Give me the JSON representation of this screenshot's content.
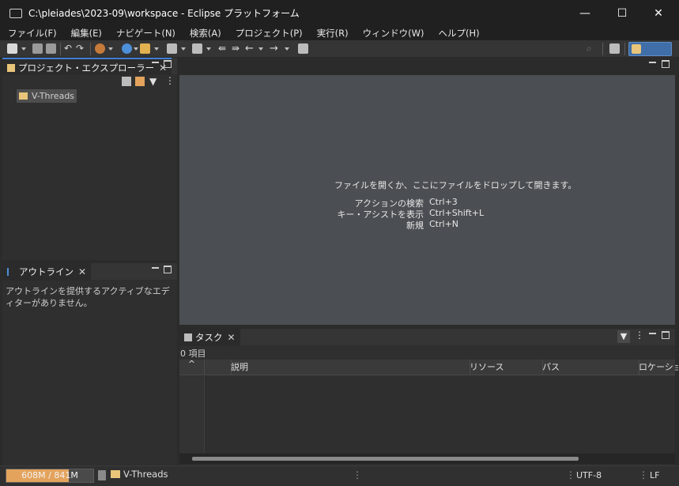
{
  "window": {
    "title": "C:\\pleiades\\2023-09\\workspace - Eclipse プラットフォーム",
    "minimize_glyph": "—",
    "maximize_glyph": "☐",
    "close_glyph": "✕"
  },
  "menu": [
    "ファイル(F)",
    "編集(E)",
    "ナビゲート(N)",
    "検索(A)",
    "プロジェクト(P)",
    "実行(R)",
    "ウィンドウ(W)",
    "ヘルプ(H)"
  ],
  "explorer": {
    "tab_label": "プロジェクト・エクスプローラー",
    "items": [
      "V-Threads"
    ]
  },
  "outline": {
    "tab_label": "アウトライン",
    "message": "アウトラインを提供するアクティブなエディターがありません。"
  },
  "editor": {
    "hint": "ファイルを開くか、ここにファイルをドロップして開きます。",
    "shortcuts": [
      {
        "label": "アクションの検索",
        "keys": "Ctrl+3"
      },
      {
        "label": "キー・アシストを表示",
        "keys": "Ctrl+Shift+L"
      },
      {
        "label": "新規",
        "keys": "Ctrl+N"
      }
    ]
  },
  "tasks": {
    "tab_label": "タスク",
    "count_label": "0 項目",
    "columns": [
      "説明",
      "リソース",
      "パス",
      "ロケーション"
    ]
  },
  "status": {
    "heap": "608M / 841M",
    "heap_fraction": 0.72,
    "project": "V-Threads",
    "encoding": "UTF-8",
    "line_ending": "LF"
  },
  "colors": {
    "accent": "#3f7fd6",
    "folder": "#e8c57a",
    "heap_fill": "#e3a35d",
    "perspective": "#3f6ea8"
  }
}
